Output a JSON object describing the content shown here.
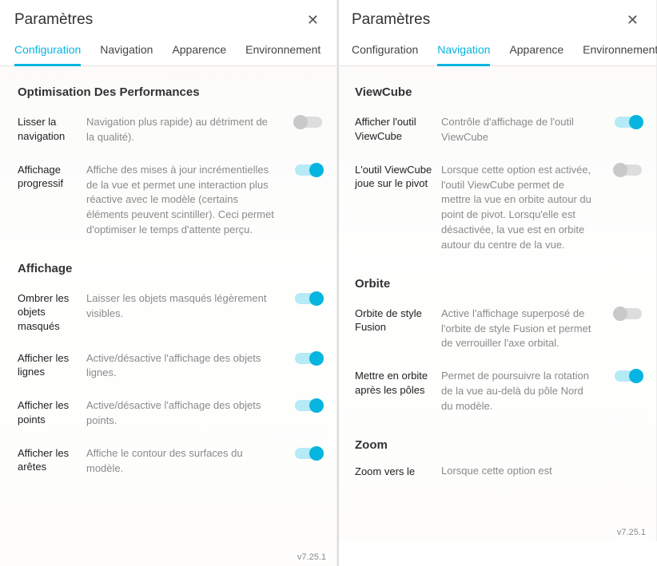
{
  "title": "Paramètres",
  "version": "v7.25.1",
  "tabs": [
    "Configuration",
    "Navigation",
    "Apparence",
    "Environnement"
  ],
  "left": {
    "activeTab": "Configuration",
    "sections": [
      {
        "title": "Optimisation Des Performances",
        "rows": [
          {
            "label": "Lisser la navigation",
            "desc": "Navigation plus rapide) au détriment de la qualité).",
            "on": false
          },
          {
            "label": "Affichage progressif",
            "desc": "Affiche des mises à jour incrémentielles de la vue et permet une interaction plus réactive avec le modèle (certains éléments peuvent scintiller). Ceci permet d'optimiser le temps d'attente perçu.",
            "on": true
          }
        ]
      },
      {
        "title": "Affichage",
        "rows": [
          {
            "label": "Ombrer les objets masqués",
            "desc": "Laisser les objets masqués légèrement visibles.",
            "on": true
          },
          {
            "label": "Afficher les lignes",
            "desc": "Active/désactive l'affichage des objets lignes.",
            "on": true
          },
          {
            "label": "Afficher les points",
            "desc": "Active/désactive l'affichage des objets points.",
            "on": true
          },
          {
            "label": "Afficher les arêtes",
            "desc": "Affiche le contour des surfaces du modèle.",
            "on": true
          }
        ]
      }
    ]
  },
  "right": {
    "activeTab": "Navigation",
    "sections": [
      {
        "title": "ViewCube",
        "rows": [
          {
            "label": "Afficher l'outil ViewCube",
            "desc": "Contrôle d'affichage de l'outil ViewCube",
            "on": true
          },
          {
            "label": "L'outil ViewCube joue sur le pivot",
            "desc": "Lorsque cette option est activée, l'outil ViewCube permet de mettre la vue en orbite autour du point de pivot. Lorsqu'elle est désactivée, la vue est en orbite autour du centre de la vue.",
            "on": false
          }
        ]
      },
      {
        "title": "Orbite",
        "rows": [
          {
            "label": "Orbite de style Fusion",
            "desc": "Active l'affichage superposé de l'orbite de style Fusion et permet de verrouiller l'axe orbital.",
            "on": false
          },
          {
            "label": "Mettre en orbite après les pôles",
            "desc": "Permet de poursuivre la rotation de la vue au-delà du pôle Nord du modèle.",
            "on": true
          }
        ]
      },
      {
        "title": "Zoom",
        "cutoff": {
          "label": "Zoom vers le",
          "desc": "Lorsque cette option est"
        }
      }
    ]
  }
}
